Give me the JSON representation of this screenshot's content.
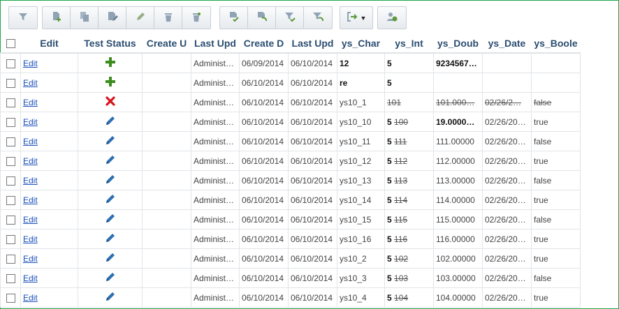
{
  "toolbar_icons": [
    "filter-icon",
    "add-record-icon",
    "copy-record-icon",
    "edit-record-icon",
    "bulk-edit-icon",
    "delete-icon",
    "bulk-delete-icon",
    "approve-icon",
    "undo-icon",
    "filter-approve-icon",
    "clear-filter-icon",
    "export-icon",
    "dropdown-arrow-icon",
    "history-icon"
  ],
  "columns": [
    "Edit",
    "Test Status",
    "Create U",
    "Last Upd",
    "Create D",
    "Last Upd",
    "ys_Char",
    "ys_Int",
    "ys_Doub",
    "ys_Date",
    "ys_Boole"
  ],
  "rows": [
    {
      "edit": "Edit",
      "status": "plus-icon",
      "create_user": "",
      "last_user": "Administ…",
      "create_date": "06/09/2014",
      "last_date": "06/10/2014",
      "char": "12",
      "char_bold": true,
      "int": "5",
      "int_old": "",
      "int_bold": true,
      "doub": "9234567…",
      "doub_bold": true,
      "date": "",
      "bool": "",
      "strike": false
    },
    {
      "edit": "Edit",
      "status": "plus-icon",
      "create_user": "",
      "last_user": "Administ…",
      "create_date": "06/10/2014",
      "last_date": "06/10/2014",
      "char": "re",
      "char_bold": true,
      "int": "5",
      "int_old": "",
      "int_bold": true,
      "doub": "",
      "doub_bold": false,
      "date": "",
      "bool": "",
      "strike": false
    },
    {
      "edit": "Edit",
      "status": "cross-icon",
      "create_user": "",
      "last_user": "Administ…",
      "create_date": "06/10/2014",
      "last_date": "06/10/2014",
      "char": "ys10_1",
      "char_bold": false,
      "int": "101",
      "int_old": "",
      "int_bold": false,
      "doub": "101.000…",
      "doub_bold": false,
      "date": "02/26/2…",
      "bool": "false",
      "strike": true
    },
    {
      "edit": "Edit",
      "status": "pencil-icon",
      "create_user": "",
      "last_user": "Administ…",
      "create_date": "06/10/2014",
      "last_date": "06/10/2014",
      "char": "ys10_10",
      "char_bold": false,
      "int": "5",
      "int_old": "100",
      "int_bold": true,
      "doub": "19.0000…",
      "doub_bold": true,
      "date": "02/26/20…",
      "bool": "true",
      "strike": false
    },
    {
      "edit": "Edit",
      "status": "pencil-icon",
      "create_user": "",
      "last_user": "Administ…",
      "create_date": "06/10/2014",
      "last_date": "06/10/2014",
      "char": "ys10_11",
      "char_bold": false,
      "int": "5",
      "int_old": "111",
      "int_bold": true,
      "doub": "111.00000",
      "doub_bold": false,
      "date": "02/26/20…",
      "bool": "false",
      "strike": false
    },
    {
      "edit": "Edit",
      "status": "pencil-icon",
      "create_user": "",
      "last_user": "Administ…",
      "create_date": "06/10/2014",
      "last_date": "06/10/2014",
      "char": "ys10_12",
      "char_bold": false,
      "int": "5",
      "int_old": "112",
      "int_bold": true,
      "doub": "112.00000",
      "doub_bold": false,
      "date": "02/26/20…",
      "bool": "true",
      "strike": false
    },
    {
      "edit": "Edit",
      "status": "pencil-icon",
      "create_user": "",
      "last_user": "Administ…",
      "create_date": "06/10/2014",
      "last_date": "06/10/2014",
      "char": "ys10_13",
      "char_bold": false,
      "int": "5",
      "int_old": "113",
      "int_bold": true,
      "doub": "113.00000",
      "doub_bold": false,
      "date": "02/26/20…",
      "bool": "false",
      "strike": false
    },
    {
      "edit": "Edit",
      "status": "pencil-icon",
      "create_user": "",
      "last_user": "Administ…",
      "create_date": "06/10/2014",
      "last_date": "06/10/2014",
      "char": "ys10_14",
      "char_bold": false,
      "int": "5",
      "int_old": "114",
      "int_bold": true,
      "doub": "114.00000",
      "doub_bold": false,
      "date": "02/26/20…",
      "bool": "true",
      "strike": false
    },
    {
      "edit": "Edit",
      "status": "pencil-icon",
      "create_user": "",
      "last_user": "Administ…",
      "create_date": "06/10/2014",
      "last_date": "06/10/2014",
      "char": "ys10_15",
      "char_bold": false,
      "int": "5",
      "int_old": "115",
      "int_bold": true,
      "doub": "115.00000",
      "doub_bold": false,
      "date": "02/26/20…",
      "bool": "false",
      "strike": false
    },
    {
      "edit": "Edit",
      "status": "pencil-icon",
      "create_user": "",
      "last_user": "Administ…",
      "create_date": "06/10/2014",
      "last_date": "06/10/2014",
      "char": "ys10_16",
      "char_bold": false,
      "int": "5",
      "int_old": "116",
      "int_bold": true,
      "doub": "116.00000",
      "doub_bold": false,
      "date": "02/26/20…",
      "bool": "true",
      "strike": false
    },
    {
      "edit": "Edit",
      "status": "pencil-icon",
      "create_user": "",
      "last_user": "Administ…",
      "create_date": "06/10/2014",
      "last_date": "06/10/2014",
      "char": "ys10_2",
      "char_bold": false,
      "int": "5",
      "int_old": "102",
      "int_bold": true,
      "doub": "102.00000",
      "doub_bold": false,
      "date": "02/26/20…",
      "bool": "true",
      "strike": false
    },
    {
      "edit": "Edit",
      "status": "pencil-icon",
      "create_user": "",
      "last_user": "Administ…",
      "create_date": "06/10/2014",
      "last_date": "06/10/2014",
      "char": "ys10_3",
      "char_bold": false,
      "int": "5",
      "int_old": "103",
      "int_bold": true,
      "doub": "103.00000",
      "doub_bold": false,
      "date": "02/26/20…",
      "bool": "false",
      "strike": false
    },
    {
      "edit": "Edit",
      "status": "pencil-icon",
      "create_user": "",
      "last_user": "Administ…",
      "create_date": "06/10/2014",
      "last_date": "06/10/2014",
      "char": "ys10_4",
      "char_bold": false,
      "int": "5",
      "int_old": "104",
      "int_bold": true,
      "doub": "104.00000",
      "doub_bold": false,
      "date": "02/26/20…",
      "bool": "true",
      "strike": false
    }
  ],
  "colors": {
    "frame": "#1ea84a",
    "header_text": "#2b4e72",
    "link": "#1a4fb8",
    "plus": "#3c8c1e",
    "cross": "#d8141b",
    "pencil": "#2c6fb3"
  }
}
